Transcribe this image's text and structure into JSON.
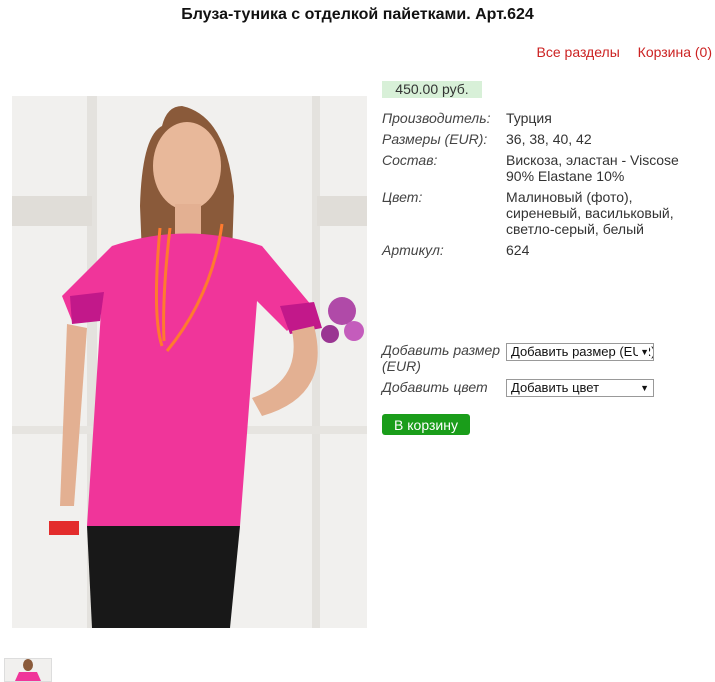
{
  "page_title": "Блуза-туника с отделкой пайетками. Арт.624",
  "nav": {
    "all_sections": "Все разделы",
    "cart": "Корзина (0)"
  },
  "price": "450.00 руб.",
  "specs": [
    {
      "label": "Производитель:",
      "value": "Турция"
    },
    {
      "label": "Размеры (EUR):",
      "value": "36, 38, 40, 42"
    },
    {
      "label": "Состав:",
      "value": "Вискоза, эластан - Viscose 90% Elastane 10%"
    },
    {
      "label": "Цвет:",
      "value": "Малиновый (фото), сиреневый, васильковый, светло-серый, белый"
    },
    {
      "label": "Артикул:",
      "value": "624"
    }
  ],
  "options": {
    "size_label": "Добавить размер (EUR)",
    "size_value": "Добавить размер (EUR)",
    "color_label": "Добавить цвет",
    "color_value": "Добавить цвет"
  },
  "add_to_cart": "В корзину",
  "colors": {
    "link": "#cc2222",
    "price_bg": "#d8f0d8",
    "button": "#1a9d1a",
    "top": "#f0359a"
  }
}
